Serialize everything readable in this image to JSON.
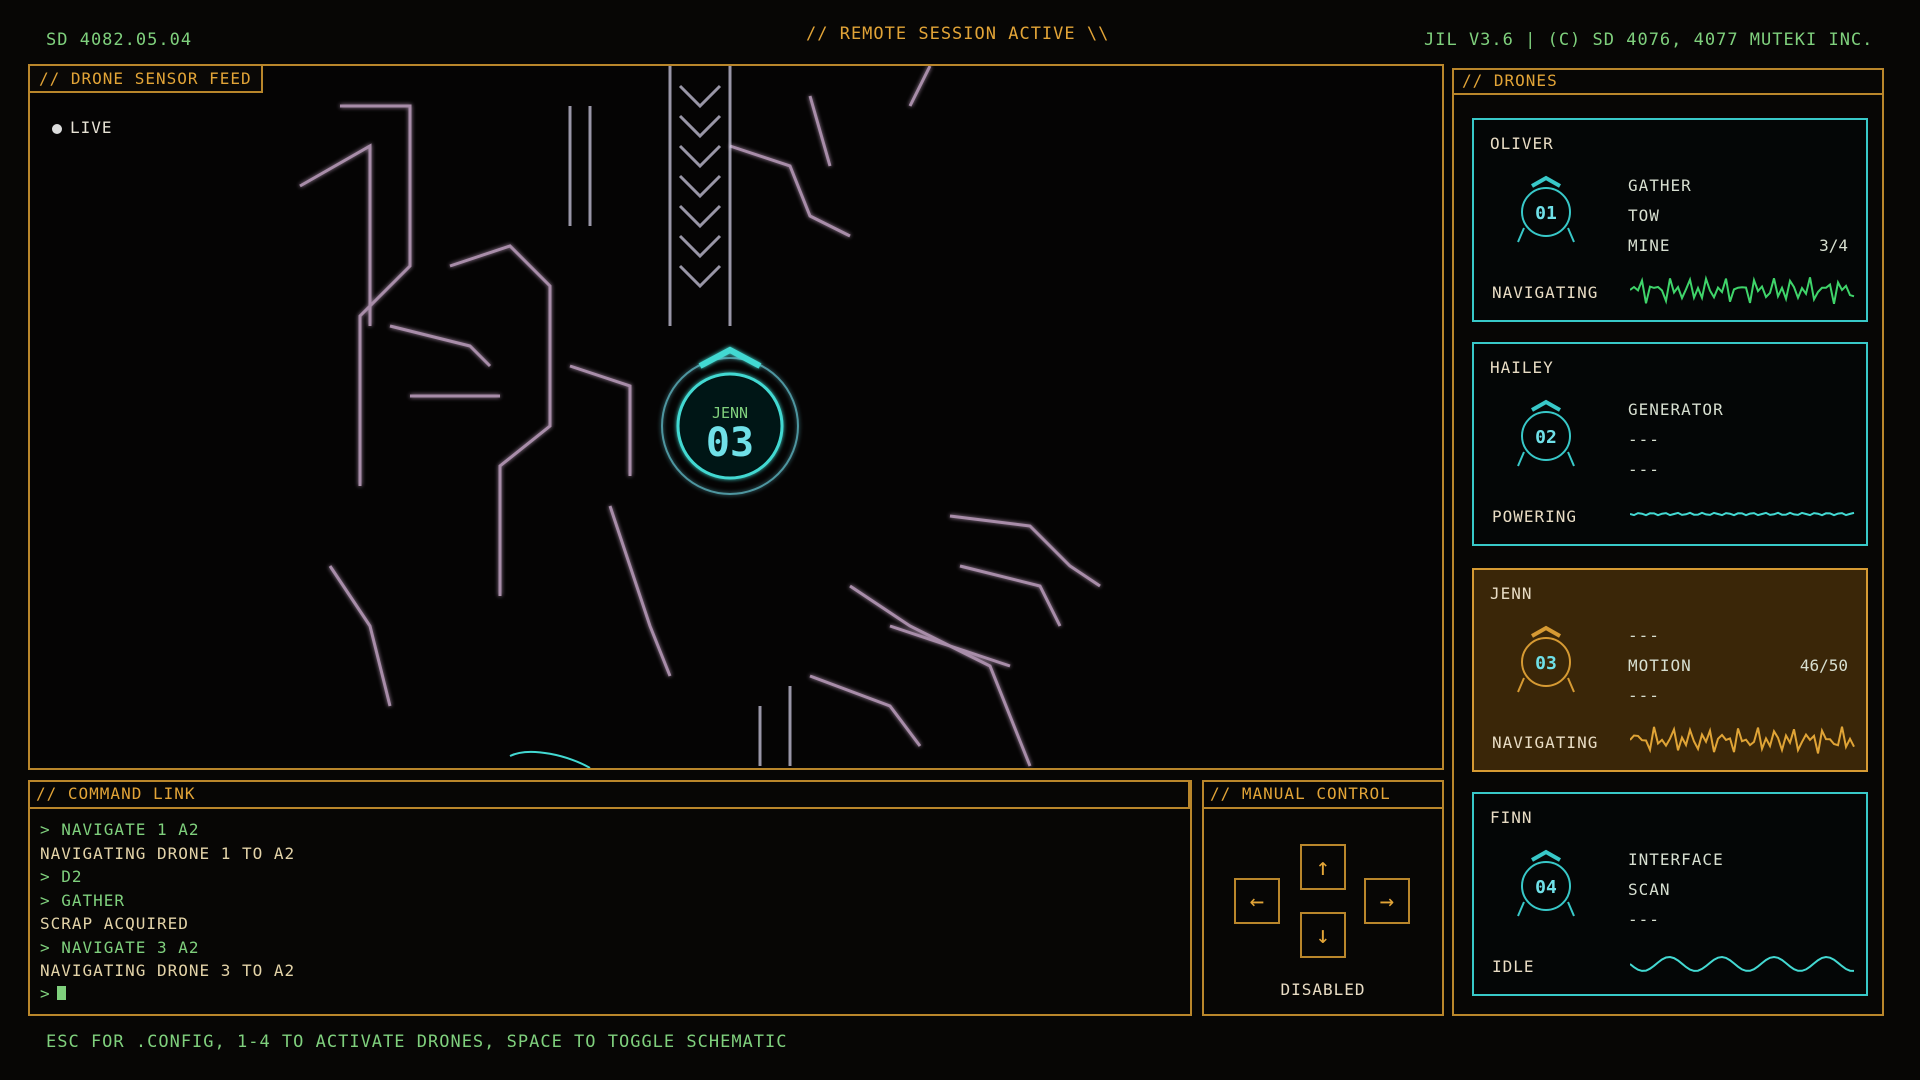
{
  "topbar": {
    "stardate": "SD 4082.05.04",
    "session": "// REMOTE SESSION ACTIVE \\\\",
    "version": "JIL V3.6  | (C) SD 4076, 4077 MUTEKI INC."
  },
  "feed": {
    "title": "// DRONE SENSOR FEED",
    "live_label": "LIVE",
    "target_name": "JENN",
    "target_id": "03"
  },
  "command": {
    "title": "// COMMAND LINK",
    "lines": [
      {
        "type": "in",
        "text": "> NAVIGATE 1 A2"
      },
      {
        "type": "out",
        "text": "NAVIGATING DRONE 1 TO A2"
      },
      {
        "type": "in",
        "text": "> D2"
      },
      {
        "type": "in",
        "text": "> GATHER"
      },
      {
        "type": "out",
        "text": "SCRAP ACQUIRED"
      },
      {
        "type": "in",
        "text": "> NAVIGATE 3 A2"
      },
      {
        "type": "out",
        "text": "NAVIGATING DRONE 3 TO A2"
      }
    ],
    "prompt": ">"
  },
  "manual": {
    "title": "// MANUAL CONTROL",
    "status": "DISABLED"
  },
  "drones": {
    "title": "// DRONES",
    "list": [
      {
        "name": "OLIVER",
        "id": "01",
        "tasks": [
          "GATHER",
          "TOW",
          "MINE"
        ],
        "count": "3/4",
        "status": "NAVIGATING",
        "active": false,
        "wave_color": "#3fd46a"
      },
      {
        "name": "HAILEY",
        "id": "02",
        "tasks": [
          "GENERATOR",
          "---",
          "---"
        ],
        "count": "",
        "status": "POWERING",
        "active": false,
        "wave_color": "#43d9d2"
      },
      {
        "name": "JENN",
        "id": "03",
        "tasks": [
          "---",
          "MOTION",
          "---"
        ],
        "count": "46/50",
        "status": "NAVIGATING",
        "active": true,
        "wave_color": "#e0a436"
      },
      {
        "name": "FINN",
        "id": "04",
        "tasks": [
          "INTERFACE",
          "SCAN",
          "---"
        ],
        "count": "",
        "status": "IDLE",
        "active": false,
        "wave_color": "#43d9d2"
      }
    ]
  },
  "footer": {
    "hint": "ESC FOR .CONFIG, 1-4 TO ACTIVATE DRONES, SPACE TO TOGGLE SCHEMATIC"
  },
  "colors": {
    "amber": "#e2a437",
    "cyan": "#38c8c8",
    "green": "#7fd07d",
    "active_card": "#3a2608"
  }
}
